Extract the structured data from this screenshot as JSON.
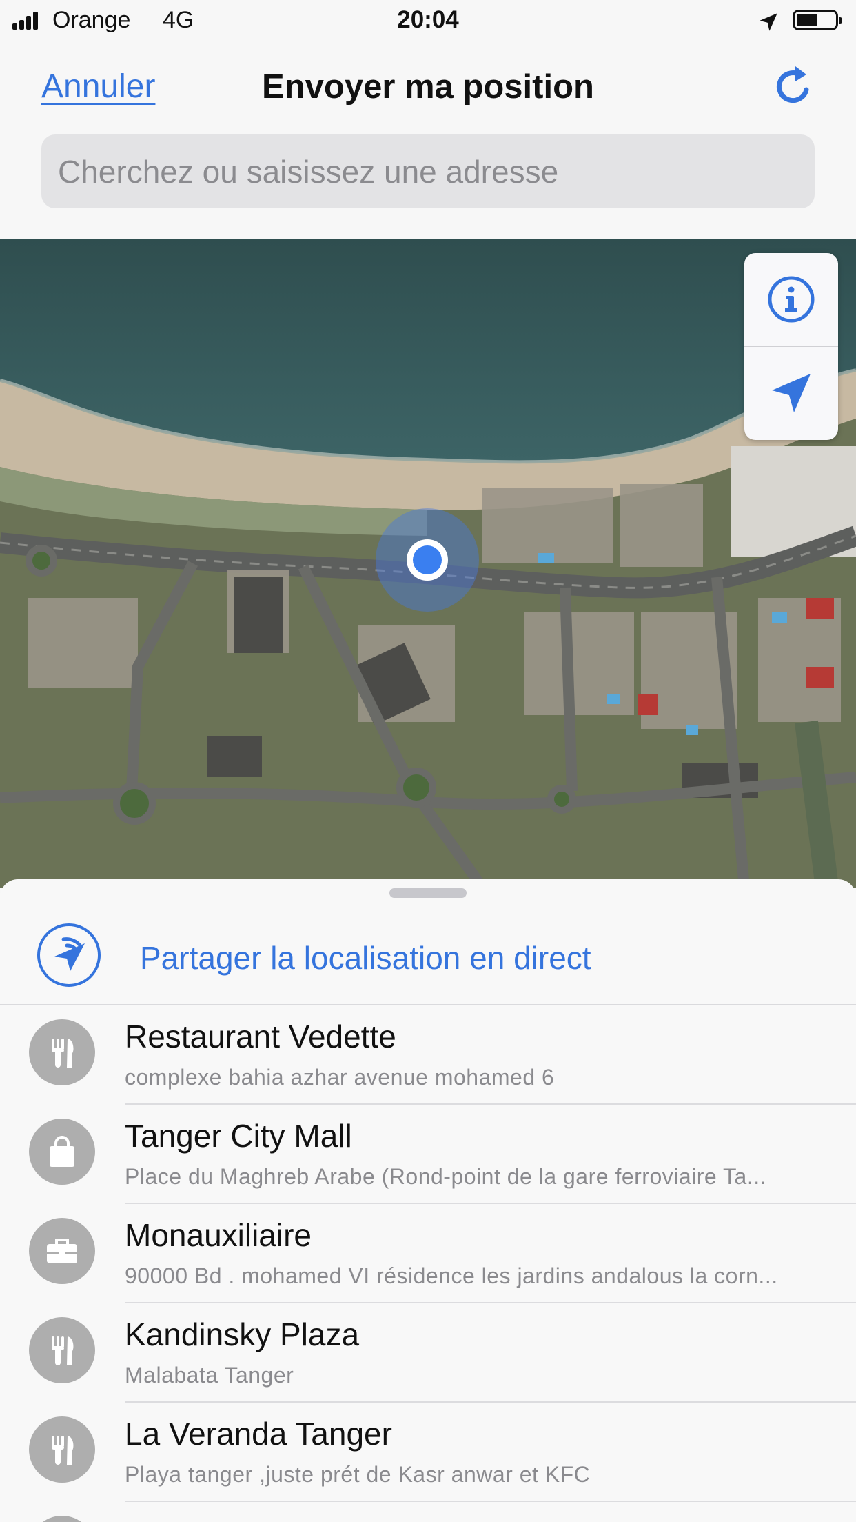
{
  "status_bar": {
    "carrier": "Orange",
    "network": "4G",
    "time": "20:04"
  },
  "nav": {
    "cancel_label": "Annuler",
    "title": "Envoyer ma position"
  },
  "search": {
    "placeholder": "Cherchez ou saisissez une adresse",
    "value": ""
  },
  "live_share": {
    "label": "Partager la localisation en direct"
  },
  "places": [
    {
      "name": "Restaurant Vedette",
      "address": "complexe bahia azhar avenue mohamed 6",
      "icon": "fork-knife-icon"
    },
    {
      "name": "Tanger City Mall",
      "address": "Place du Maghreb Arabe  (Rond-point de la gare ferroviaire Ta...",
      "icon": "shopping-bag-icon"
    },
    {
      "name": "Monauxiliaire",
      "address": "90000 Bd . mohamed VI résidence les jardins andalous la corn...",
      "icon": "briefcase-icon"
    },
    {
      "name": "Kandinsky Plaza",
      "address": "Malabata Tanger",
      "icon": "fork-knife-icon"
    },
    {
      "name": "La Veranda Tanger",
      "address": "Playa tanger ,juste prét de Kasr anwar et KFC",
      "icon": "fork-knife-icon"
    }
  ],
  "colors": {
    "accent": "#3574dd",
    "user_dot": "#3a7ff0",
    "place_icon_bg": "#aeaeae"
  }
}
